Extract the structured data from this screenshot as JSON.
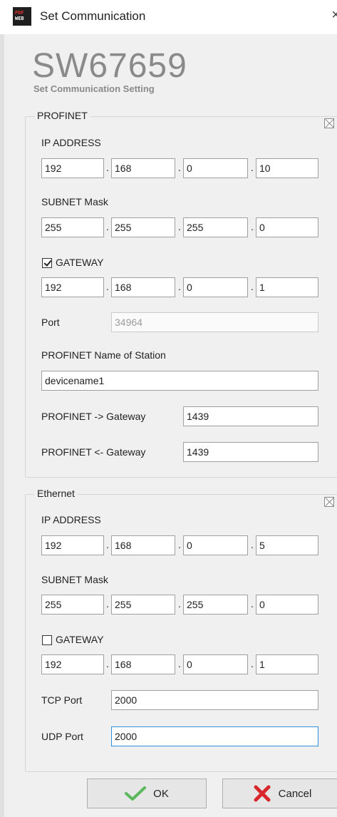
{
  "window": {
    "title": "Set Communication",
    "icon_lines": [
      "PDF",
      "WEB"
    ],
    "close_glyph": "×"
  },
  "header": {
    "product": "SW67659",
    "subtitle": "Set Communication Setting"
  },
  "profinet": {
    "legend": "PROFINET",
    "ip_label": "IP ADDRESS",
    "ip": [
      "192",
      "168",
      "0",
      "10"
    ],
    "subnet_label": "SUBNET Mask",
    "subnet": [
      "255",
      "255",
      "255",
      "0"
    ],
    "gateway_label": "GATEWAY",
    "gateway_checked": true,
    "gateway": [
      "192",
      "168",
      "0",
      "1"
    ],
    "port_label": "Port",
    "port": "34964",
    "station_label": "PROFINET Name of Station",
    "station": "devicename1",
    "to_gw_label": "PROFINET -> Gateway",
    "to_gw": "1439",
    "from_gw_label": "PROFINET <- Gateway",
    "from_gw": "1439"
  },
  "ethernet": {
    "legend": "Ethernet",
    "ip_label": "IP ADDRESS",
    "ip": [
      "192",
      "168",
      "0",
      "5"
    ],
    "subnet_label": "SUBNET Mask",
    "subnet": [
      "255",
      "255",
      "255",
      "0"
    ],
    "gateway_label": "GATEWAY",
    "gateway_checked": false,
    "gateway": [
      "192",
      "168",
      "0",
      "1"
    ],
    "tcp_label": "TCP Port",
    "tcp": "2000",
    "udp_label": "UDP Port",
    "udp": "2000"
  },
  "dot": ".",
  "buttons": {
    "ok": "OK",
    "cancel": "Cancel"
  },
  "colors": {
    "accent": "#2f8fe0",
    "ok_icon": "#5cb85c",
    "cancel_icon": "#d9262c"
  },
  "icons": {
    "collapse": "collapse-x-icon",
    "ok": "checkmark-icon",
    "cancel": "red-x-icon"
  }
}
